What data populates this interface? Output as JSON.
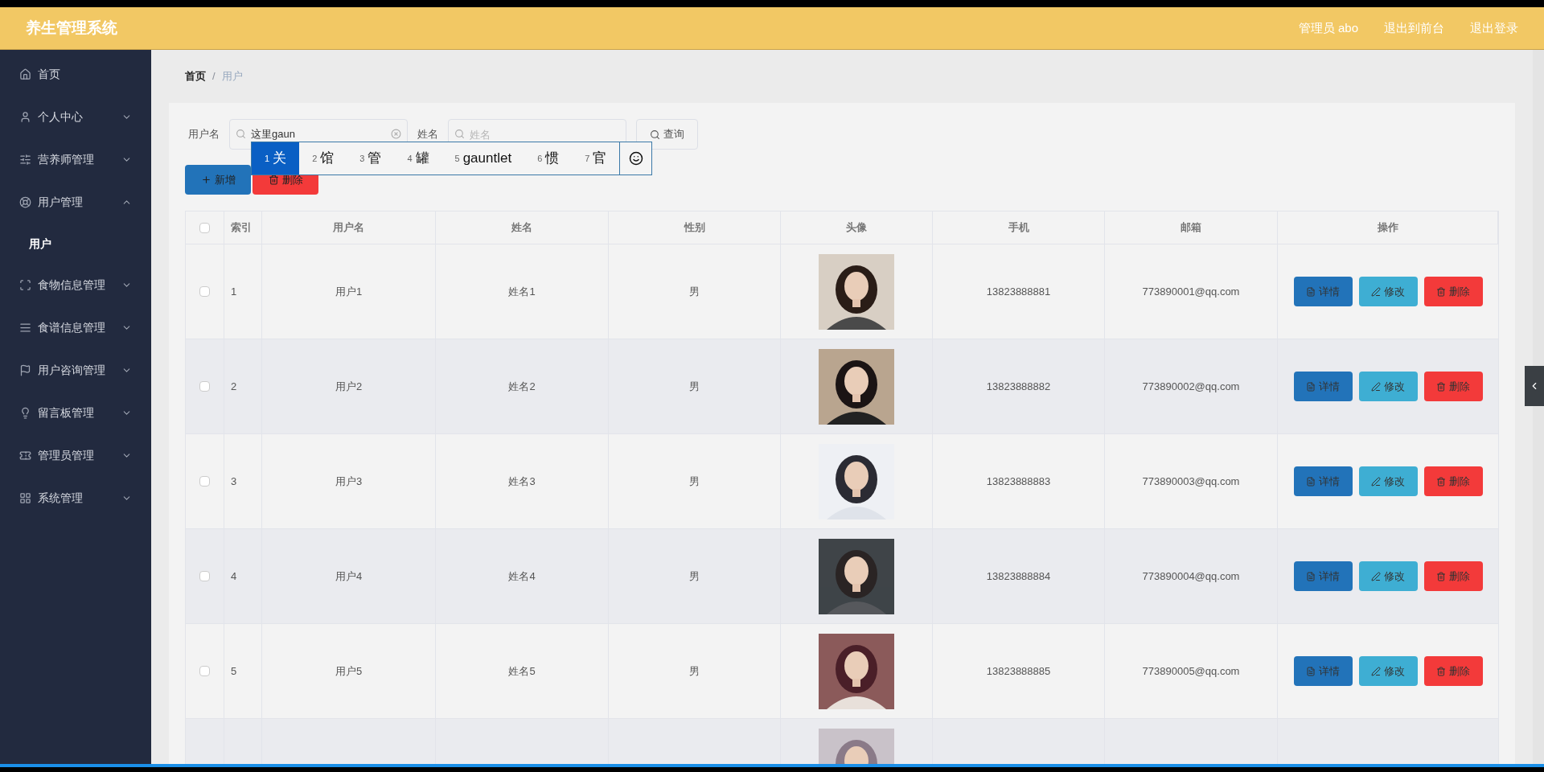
{
  "header": {
    "title": "养生管理系统",
    "links": [
      "管理员 abo",
      "退出到前台",
      "退出登录"
    ]
  },
  "sidebar": {
    "items": [
      {
        "label": "首页"
      },
      {
        "label": "个人中心",
        "expanded": false
      },
      {
        "label": "营养师管理",
        "expanded": false
      },
      {
        "label": "用户管理",
        "expanded": true,
        "children": [
          {
            "label": "用户",
            "selected": true
          }
        ]
      },
      {
        "label": "食物信息管理",
        "expanded": false
      },
      {
        "label": "食谱信息管理",
        "expanded": false
      },
      {
        "label": "用户咨询管理",
        "expanded": false
      },
      {
        "label": "留言板管理",
        "expanded": false
      },
      {
        "label": "管理员管理",
        "expanded": false
      },
      {
        "label": "系统管理",
        "expanded": false
      }
    ]
  },
  "breadcrumb": {
    "items": [
      "首页",
      "用户"
    ],
    "separator": "/"
  },
  "search": {
    "fields": [
      {
        "label": "用户名",
        "value": "这里gaun"
      },
      {
        "label": "姓名",
        "placeholder": "姓名"
      }
    ],
    "button": "查询"
  },
  "ime_candidates": [
    {
      "index": "1",
      "text": "关",
      "selected": true
    },
    {
      "index": "2",
      "text": "馆",
      "selected": false
    },
    {
      "index": "3",
      "text": "管",
      "selected": false
    },
    {
      "index": "4",
      "text": "罐",
      "selected": false
    },
    {
      "index": "5",
      "text": "gauntlet",
      "selected": false
    },
    {
      "index": "6",
      "text": "惯",
      "selected": false
    },
    {
      "index": "7",
      "text": "官",
      "selected": false
    }
  ],
  "actions": [
    "新增",
    "删除"
  ],
  "table": {
    "header_checked": false,
    "columns": [
      "索引",
      "用户名",
      "姓名",
      "性别",
      "头像",
      "手机",
      "邮箱",
      "操作"
    ],
    "rows": [
      {
        "index": "1",
        "username": "用户1",
        "name": "姓名1",
        "gender": "男",
        "avatar": {
          "kind": "picture"
        },
        "phone": "13823888881",
        "email": "773890001@qq.com",
        "checked": false,
        "buttons": [
          {
            "kind": "detail",
            "label": "详情"
          },
          {
            "kind": "edit",
            "label": "修改"
          },
          {
            "kind": "delete",
            "label": "删除"
          }
        ]
      },
      {
        "index": "2",
        "username": "用户2",
        "name": "姓名2",
        "gender": "男",
        "avatar": {
          "kind": "picture"
        },
        "phone": "13823888882",
        "email": "773890002@qq.com",
        "checked": false,
        "buttons": [
          {
            "kind": "detail",
            "label": "详情"
          },
          {
            "kind": "edit",
            "label": "修改"
          },
          {
            "kind": "delete",
            "label": "删除"
          }
        ]
      },
      {
        "index": "3",
        "username": "用户3",
        "name": "姓名3",
        "gender": "男",
        "avatar": {
          "kind": "picture"
        },
        "phone": "13823888883",
        "email": "773890003@qq.com",
        "checked": false,
        "buttons": [
          {
            "kind": "detail",
            "label": "详情"
          },
          {
            "kind": "edit",
            "label": "修改"
          },
          {
            "kind": "delete",
            "label": "删除"
          }
        ]
      },
      {
        "index": "4",
        "username": "用户4",
        "name": "姓名4",
        "gender": "男",
        "avatar": {
          "kind": "picture"
        },
        "phone": "13823888884",
        "email": "773890004@qq.com",
        "checked": false,
        "buttons": [
          {
            "kind": "detail",
            "label": "详情"
          },
          {
            "kind": "edit",
            "label": "修改"
          },
          {
            "kind": "delete",
            "label": "删除"
          }
        ]
      },
      {
        "index": "5",
        "username": "用户5",
        "name": "姓名5",
        "gender": "男",
        "avatar": {
          "kind": "picture"
        },
        "phone": "13823888885",
        "email": "773890005@qq.com",
        "checked": false,
        "buttons": [
          {
            "kind": "detail",
            "label": "详情"
          },
          {
            "kind": "edit",
            "label": "修改"
          },
          {
            "kind": "delete",
            "label": "删除"
          }
        ]
      },
      {
        "avatar": {
          "kind": "picture"
        }
      }
    ]
  }
}
